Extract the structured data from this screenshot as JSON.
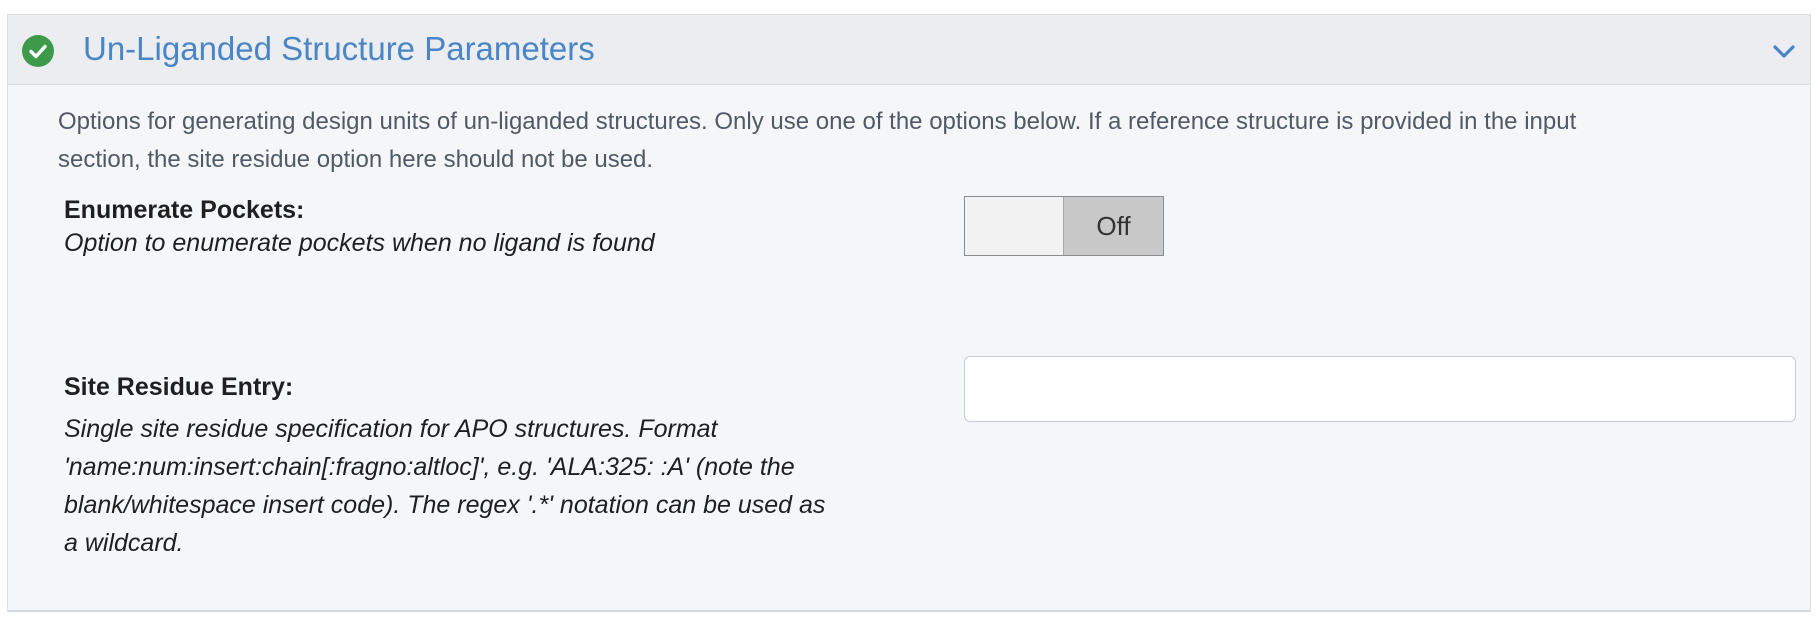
{
  "section": {
    "title": "Un-Liganded Structure Parameters",
    "status_icon": "check-circle-icon",
    "collapse_icon": "chevron-down-icon",
    "description_lines": [
      "Options for generating design units of un-liganded structures. Only use one of the options below. If a reference structure is provided in the input",
      "section, the site residue option here should not be used."
    ],
    "colors": {
      "title": "#4a86c5",
      "status": "#3d9a4b",
      "header_bg": "#ebedf0",
      "body_bg": "#f5f6f8"
    }
  },
  "fields": {
    "enumerate_pockets": {
      "label": "Enumerate Pockets:",
      "help": "Option to enumerate pockets when no ligand is found",
      "toggle_state": "Off"
    },
    "site_residue": {
      "label": "Site Residue Entry:",
      "help_lines": [
        "Single site residue specification for APO structures. Format",
        "'name:num:insert:chain[:fragno:altloc]', e.g. 'ALA:325: :A' (note the",
        "blank/whitespace insert code). The regex '.*' notation can be used as",
        "a wildcard."
      ],
      "value": "",
      "placeholder": ""
    }
  }
}
